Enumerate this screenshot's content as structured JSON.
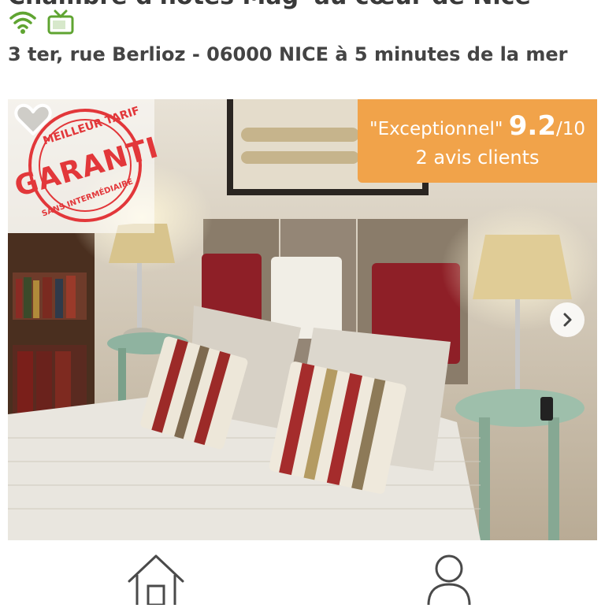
{
  "listing": {
    "title": "Chambre d'hôtes Mag' au cœur de Nice",
    "address": "3 ter, rue Berlioz - 06000 NICE à 5 minutes de la mer",
    "amenities": [
      {
        "icon": "wifi-icon",
        "color": "#5fa431"
      },
      {
        "icon": "tv-icon",
        "color": "#5fa431"
      }
    ]
  },
  "badge": {
    "line1": "MEILLEUR TARIF",
    "main": "GARANTI",
    "line2": "SANS INTERMÉDIAIRE",
    "color": "#e2373a"
  },
  "rating": {
    "label": "\"Exceptionnel\"",
    "score": "9.2",
    "max": "/10",
    "reviews": "2 avis clients",
    "background": "#f1a34a"
  },
  "nav": {
    "items": [
      {
        "icon": "home-icon"
      },
      {
        "icon": "user-icon"
      }
    ]
  }
}
